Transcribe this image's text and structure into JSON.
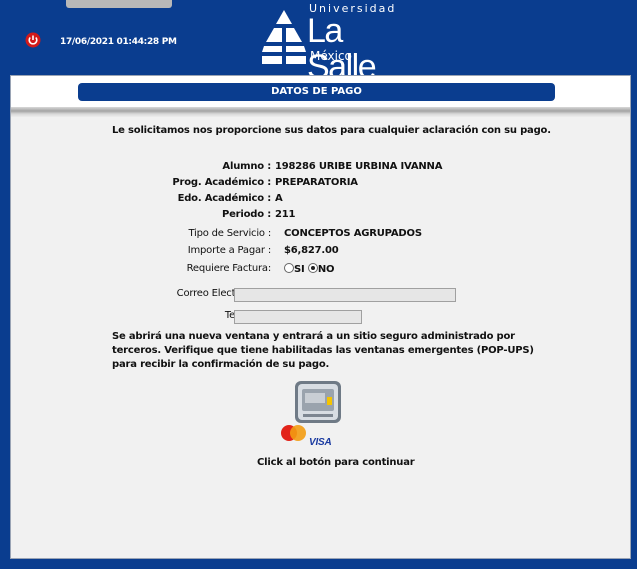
{
  "header": {
    "datetime": "17/06/2021 01:44:28 PM",
    "logo": {
      "top": "Universidad",
      "main": "La Salle",
      "sub": "México"
    }
  },
  "panel": {
    "title": "DATOS DE PAGO",
    "intro": "Le solicitamos nos proporcione sus datos para cualquier aclaración con su pago.",
    "fields": {
      "alumno": {
        "label": "Alumno :",
        "value": "198286 URIBE URBINA IVANNA"
      },
      "programa": {
        "label": "Prog. Académico :",
        "value": "PREPARATORIA"
      },
      "estado": {
        "label": "Edo. Académico :",
        "value": "A"
      },
      "periodo": {
        "label": "Periodo :",
        "value": "211"
      },
      "servicio": {
        "label": "Tipo de Servicio :",
        "value": "CONCEPTOS AGRUPADOS"
      },
      "importe": {
        "label": "Importe a Pagar :",
        "value": "$6,827.00"
      },
      "factura": {
        "label": "Requiere Factura:",
        "options": [
          "SI",
          "NO"
        ],
        "selected": "NO"
      },
      "correo": {
        "label": "Correo Electrónico :",
        "value": ""
      },
      "telefono": {
        "label": "Teléfono :",
        "value": ""
      }
    },
    "notice": "Se abrirá una nueva ventana y entrará a un sitio seguro administrado por terceros. Verifique que tiene habilitadas las ventanas emergentes (POP-UPS) para recibir la confirmación de su pago.",
    "pay_button": {
      "icon": "credit-card-icon",
      "brands": [
        "Mastercard",
        "VISA"
      ]
    },
    "click_text": "Click al botón para continuar"
  },
  "colors": {
    "brand_blue": "#0a3d8f",
    "panel_bg": "#f1f1f1"
  }
}
